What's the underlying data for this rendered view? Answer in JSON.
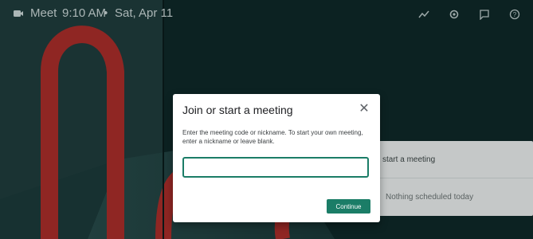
{
  "topbar": {
    "app_title": "Meet",
    "time": "9:10 AM",
    "separator": "•",
    "date": "Sat, Apr 11",
    "actions": {
      "activity_icon": "activity-icon",
      "settings_icon": "settings-icon",
      "feedback_icon": "feedback-icon",
      "help_icon": "help-icon"
    }
  },
  "side_panel": {
    "start_meeting": "start a meeting",
    "nothing_scheduled": "Nothing scheduled today"
  },
  "dialog": {
    "title": "Join or start a meeting",
    "close_icon": "close-icon",
    "description": "Enter the meeting code or nickname. To start your own meeting, enter a nickname or leave blank.",
    "input_value": "",
    "continue_label": "Continue"
  },
  "colors": {
    "accent": "#1b7d67",
    "background": "#0f2a2a",
    "sculpture_red": "#a82d2a"
  }
}
